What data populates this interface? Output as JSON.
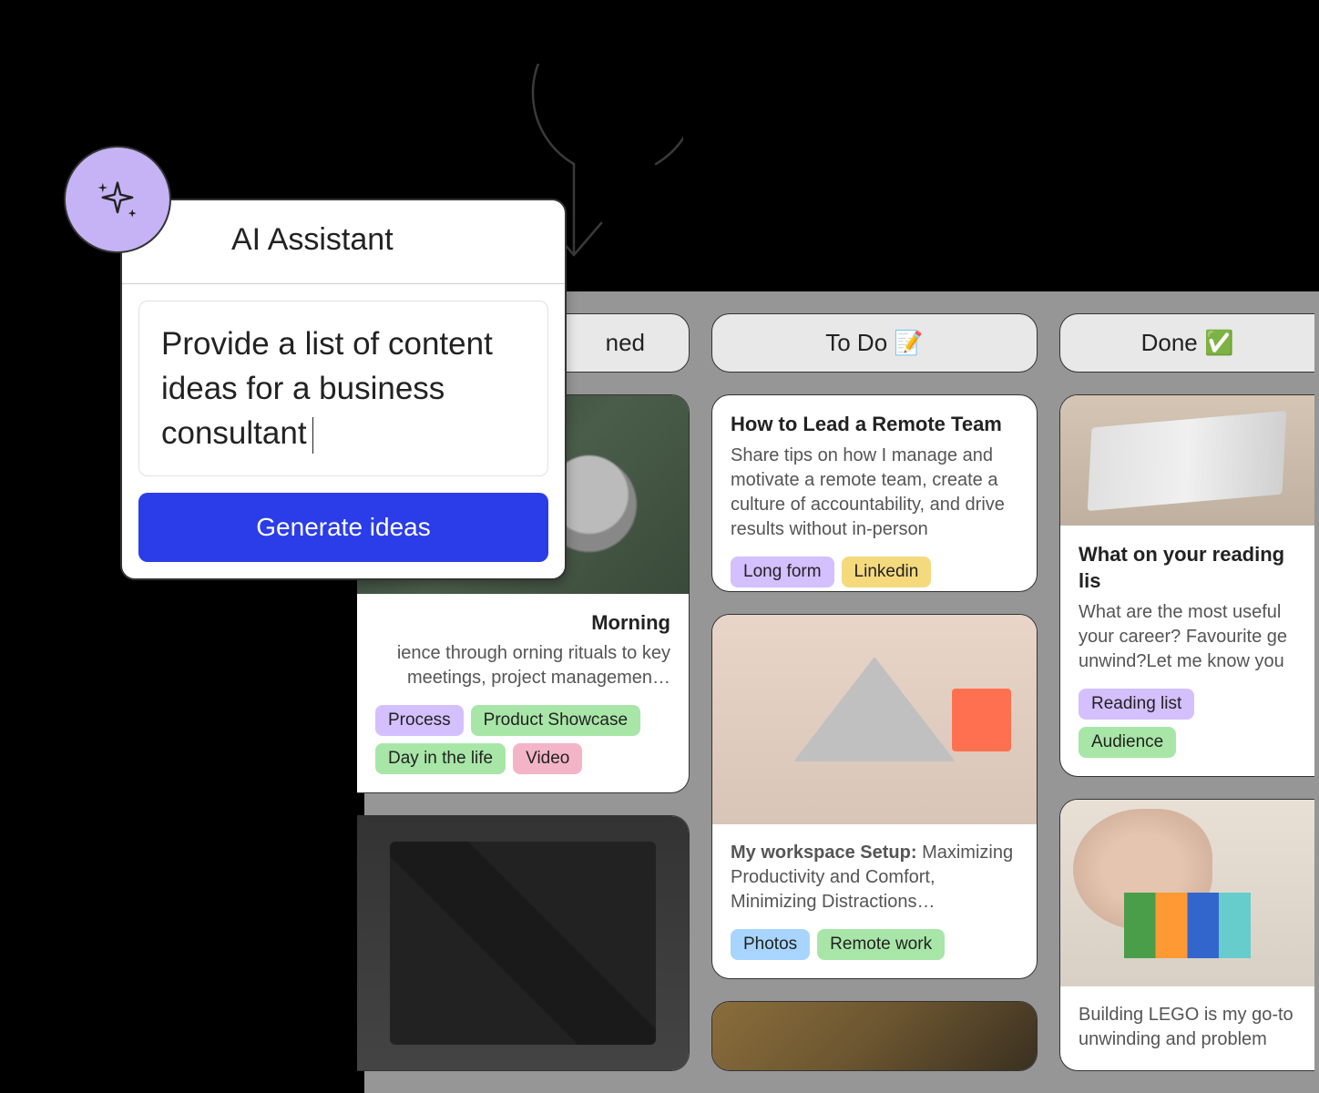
{
  "ai_modal": {
    "title": "AI Assistant",
    "prompt_text": "Provide a list of content ideas for a business consultant",
    "button_label": "Generate ideas"
  },
  "columns": [
    {
      "header": "ned",
      "cards": [
        {
          "title_suffix": "Morning",
          "description": "ience through orning rituals to key meetings, project managemen…",
          "tags": [
            {
              "label": "Process",
              "color": "purple"
            },
            {
              "label": "Product Showcase",
              "color": "green"
            },
            {
              "label": "Day in the life",
              "color": "green"
            },
            {
              "label": "Video",
              "color": "pink"
            }
          ]
        },
        {
          "title": "",
          "description": "",
          "tags": []
        }
      ]
    },
    {
      "header": "To Do 📝",
      "cards": [
        {
          "title": "How to Lead a Remote Team",
          "description": "Share tips on how I manage and motivate a remote team, create a culture of accountability, and drive results without in-person",
          "tags": [
            {
              "label": "Long form",
              "color": "purple"
            },
            {
              "label": "Linkedin",
              "color": "yellow"
            }
          ]
        },
        {
          "title_prefix": "My workspace Setup:",
          "description_inline": " Maximizing Productivity and Comfort, Minimizing Distractions…",
          "tags": [
            {
              "label": "Photos",
              "color": "blue"
            },
            {
              "label": "Remote work",
              "color": "green"
            }
          ]
        },
        {
          "title": "",
          "description": "",
          "tags": []
        }
      ]
    },
    {
      "header": "Done ✅",
      "cards": [
        {
          "title": "What on your reading lis",
          "description": "What are the most useful your career? Favourite ge unwind?Let me know you",
          "tags": [
            {
              "label": "Reading list",
              "color": "purple"
            },
            {
              "label": "Audience",
              "color": "green"
            }
          ]
        },
        {
          "description_below": "Building LEGO is my go-to unwinding and problem",
          "tags": []
        }
      ]
    }
  ]
}
